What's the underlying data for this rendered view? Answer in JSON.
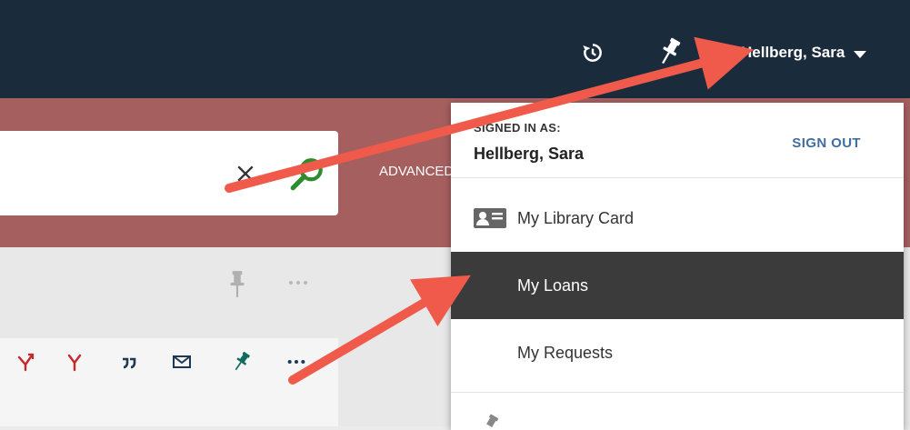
{
  "header": {
    "user_name": "Hellberg, Sara",
    "icons": [
      "history-icon",
      "pin-icon",
      "caret-down-icon"
    ]
  },
  "search": {
    "value": "",
    "advanced_label": "ADVANCED SEARCH",
    "icons": [
      "close-icon",
      "search-icon"
    ]
  },
  "result": {
    "icons": [
      "pin-icon",
      "more-icon"
    ],
    "actions": [
      "export-icon",
      "fork-icon",
      "quote-icon",
      "email-icon",
      "pin-icon",
      "more-icon"
    ]
  },
  "dropdown": {
    "signed_in_label": "SIGNED IN AS:",
    "signed_in_name": "Hellberg, Sara",
    "sign_out_label": "SIGN OUT",
    "items": [
      {
        "label": "My Library Card",
        "icon": "library-card-icon"
      },
      {
        "label": "My Loans",
        "active": true
      },
      {
        "label": "My Requests"
      }
    ]
  },
  "colors": {
    "topbar": "#1a2b3b",
    "search_band": "#a55f5f",
    "active_item": "#3b3b3b",
    "sign_out": "#3f6f9e",
    "arrow": "#f05a4b",
    "search_icon": "#2e8b2e",
    "action_red": "#c62828",
    "action_teal": "#11695f"
  }
}
